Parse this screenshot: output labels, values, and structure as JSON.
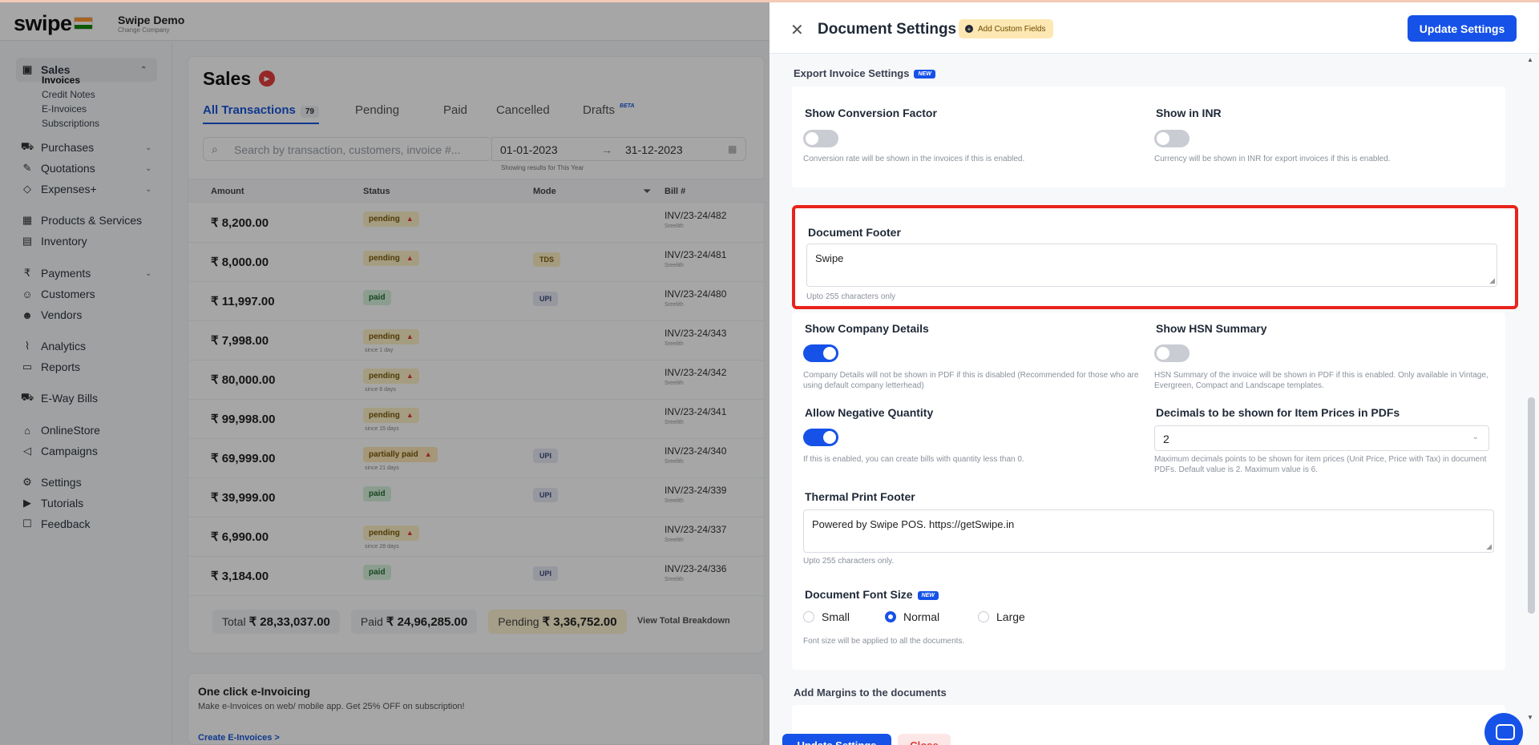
{
  "app": {
    "logo": "swipe",
    "company_name": "Swipe Demo",
    "company_sub": "Change Company"
  },
  "sidebar": {
    "sales": "Sales",
    "sales_sub": [
      "Invoices",
      "Credit Notes",
      "E-Invoices",
      "Subscriptions"
    ],
    "items": [
      {
        "label": "Purchases",
        "icon": "cart-icon"
      },
      {
        "label": "Quotations",
        "icon": "pen-icon"
      },
      {
        "label": "Expenses+",
        "icon": "tag-icon"
      },
      {
        "label": "Products & Services",
        "icon": "box-icon"
      },
      {
        "label": "Inventory",
        "icon": "warehouse-icon"
      },
      {
        "label": "Payments",
        "icon": "rupee-icon"
      },
      {
        "label": "Customers",
        "icon": "user-icon"
      },
      {
        "label": "Vendors",
        "icon": "users-icon"
      },
      {
        "label": "Analytics",
        "icon": "chart-icon"
      },
      {
        "label": "Reports",
        "icon": "report-icon"
      },
      {
        "label": "E-Way Bills",
        "icon": "truck-icon"
      },
      {
        "label": "OnlineStore",
        "icon": "store-icon"
      },
      {
        "label": "Campaigns",
        "icon": "megaphone-icon"
      },
      {
        "label": "Settings",
        "icon": "gear-icon"
      },
      {
        "label": "Tutorials",
        "icon": "youtube-icon"
      },
      {
        "label": "Feedback",
        "icon": "chat-icon"
      }
    ]
  },
  "sales": {
    "title": "Sales",
    "tabs": [
      {
        "label": "All Transactions",
        "count": "79"
      },
      {
        "label": "Pending"
      },
      {
        "label": "Paid"
      },
      {
        "label": "Cancelled"
      },
      {
        "label": "Drafts",
        "badge": "BETA"
      }
    ],
    "search_placeholder": "Search by transaction, customers, invoice #...",
    "date_from": "01-01-2023",
    "date_arrow": "→",
    "date_to": "31-12-2023",
    "date_note": "Showing results for This Year",
    "columns": [
      "Amount",
      "Status",
      "Mode",
      "Bill #"
    ],
    "rows": [
      {
        "amount": "₹ 8,200.00",
        "status": "pending",
        "since": "",
        "mode": "",
        "bill": "INV/23-24/482",
        "sub": "Sreelith"
      },
      {
        "amount": "₹ 8,000.00",
        "status": "pending",
        "since": "",
        "mode": "TDS",
        "bill": "INV/23-24/481",
        "sub": "Sreelith"
      },
      {
        "amount": "₹ 11,997.00",
        "status": "paid",
        "since": "",
        "mode": "UPI",
        "bill": "INV/23-24/480",
        "sub": "Sreelith"
      },
      {
        "amount": "₹ 7,998.00",
        "status": "pending",
        "since": "since 1 day",
        "mode": "",
        "bill": "INV/23-24/343",
        "sub": "Sreelith"
      },
      {
        "amount": "₹ 80,000.00",
        "status": "pending",
        "since": "since 8 days",
        "mode": "",
        "bill": "INV/23-24/342",
        "sub": "Sreelith"
      },
      {
        "amount": "₹ 99,998.00",
        "status": "pending",
        "since": "since 15 days",
        "mode": "",
        "bill": "INV/23-24/341",
        "sub": "Sreelith"
      },
      {
        "amount": "₹ 69,999.00",
        "status": "partially paid",
        "since": "since 21 days",
        "mode": "UPI",
        "bill": "INV/23-24/340",
        "sub": "Sreelith"
      },
      {
        "amount": "₹ 39,999.00",
        "status": "paid",
        "since": "",
        "mode": "UPI",
        "bill": "INV/23-24/339",
        "sub": "Sreelith"
      },
      {
        "amount": "₹ 6,990.00",
        "status": "pending",
        "since": "since 28 days",
        "mode": "",
        "bill": "INV/23-24/337",
        "sub": "Sreelith"
      },
      {
        "amount": "₹ 3,184.00",
        "status": "paid",
        "since": "",
        "mode": "UPI",
        "bill": "INV/23-24/336",
        "sub": "Sreelith"
      }
    ],
    "totals": {
      "total_label": "Total",
      "total": "₹ 28,33,037.00",
      "paid_label": "Paid",
      "paid": "₹ 24,96,285.00",
      "pending_label": "Pending",
      "pending": "₹ 3,36,752.00",
      "breakdown": "View Total Breakdown"
    }
  },
  "promo": {
    "title": "One click e-Invoicing",
    "desc": "Make e-Invoices on web/ mobile app. Get 25% OFF on subscription!",
    "link": "Create E-Invoices >"
  },
  "drawer": {
    "title": "Document Settings",
    "add_custom_fields": "Add Custom Fields",
    "update_settings": "Update Settings",
    "new_badge": "NEW",
    "export_section": "Export Invoice Settings",
    "conversion_label": "Show Conversion Factor",
    "conversion_hint": "Conversion rate will be shown in the invoices if this is enabled.",
    "inr_label": "Show in INR",
    "inr_hint": "Currency will be shown in INR for export invoices if this is enabled.",
    "footer_label": "Document Footer",
    "footer_value": "Swipe",
    "footer_hint": "Upto 255 characters only",
    "company_label": "Show Company Details",
    "company_hint": "Company Details will not be shown in PDF if this is disabled (Recommended for those who are using default company letterhead)",
    "hsn_label": "Show HSN Summary",
    "hsn_hint": "HSN Summary of the invoice will be shown in PDF if this is enabled. Only available in Vintage, Evergreen, Compact and Landscape templates.",
    "negqty_label": "Allow Negative Quantity",
    "negqty_hint": "If this is enabled, you can create bills with quantity less than 0.",
    "decimals_label": "Decimals to be shown for Item Prices in PDFs",
    "decimals_value": "2",
    "decimals_hint": "Maximum decimals points to be shown for item prices (Unit Price, Price with Tax) in document PDFs. Default value is 2. Maximum value is 6.",
    "thermal_label": "Thermal Print Footer",
    "thermal_value": "Powered by Swipe POS. https://getSwipe.in",
    "thermal_hint": "Upto 255 characters only.",
    "fontsize_label": "Document Font Size",
    "fontsize_options": [
      "Small",
      "Normal",
      "Large"
    ],
    "fontsize_selected": "Normal",
    "fontsize_hint": "Font size will be applied to all the documents.",
    "margins_section": "Add Margins to the documents",
    "footer_update": "Update Settings",
    "footer_close": "Close",
    "toggles": {
      "conversion": false,
      "inr": false,
      "company": true,
      "hsn": false,
      "negqty": true
    }
  },
  "colors": {
    "accent": "#1652e8",
    "highlight": "#e8231b"
  }
}
